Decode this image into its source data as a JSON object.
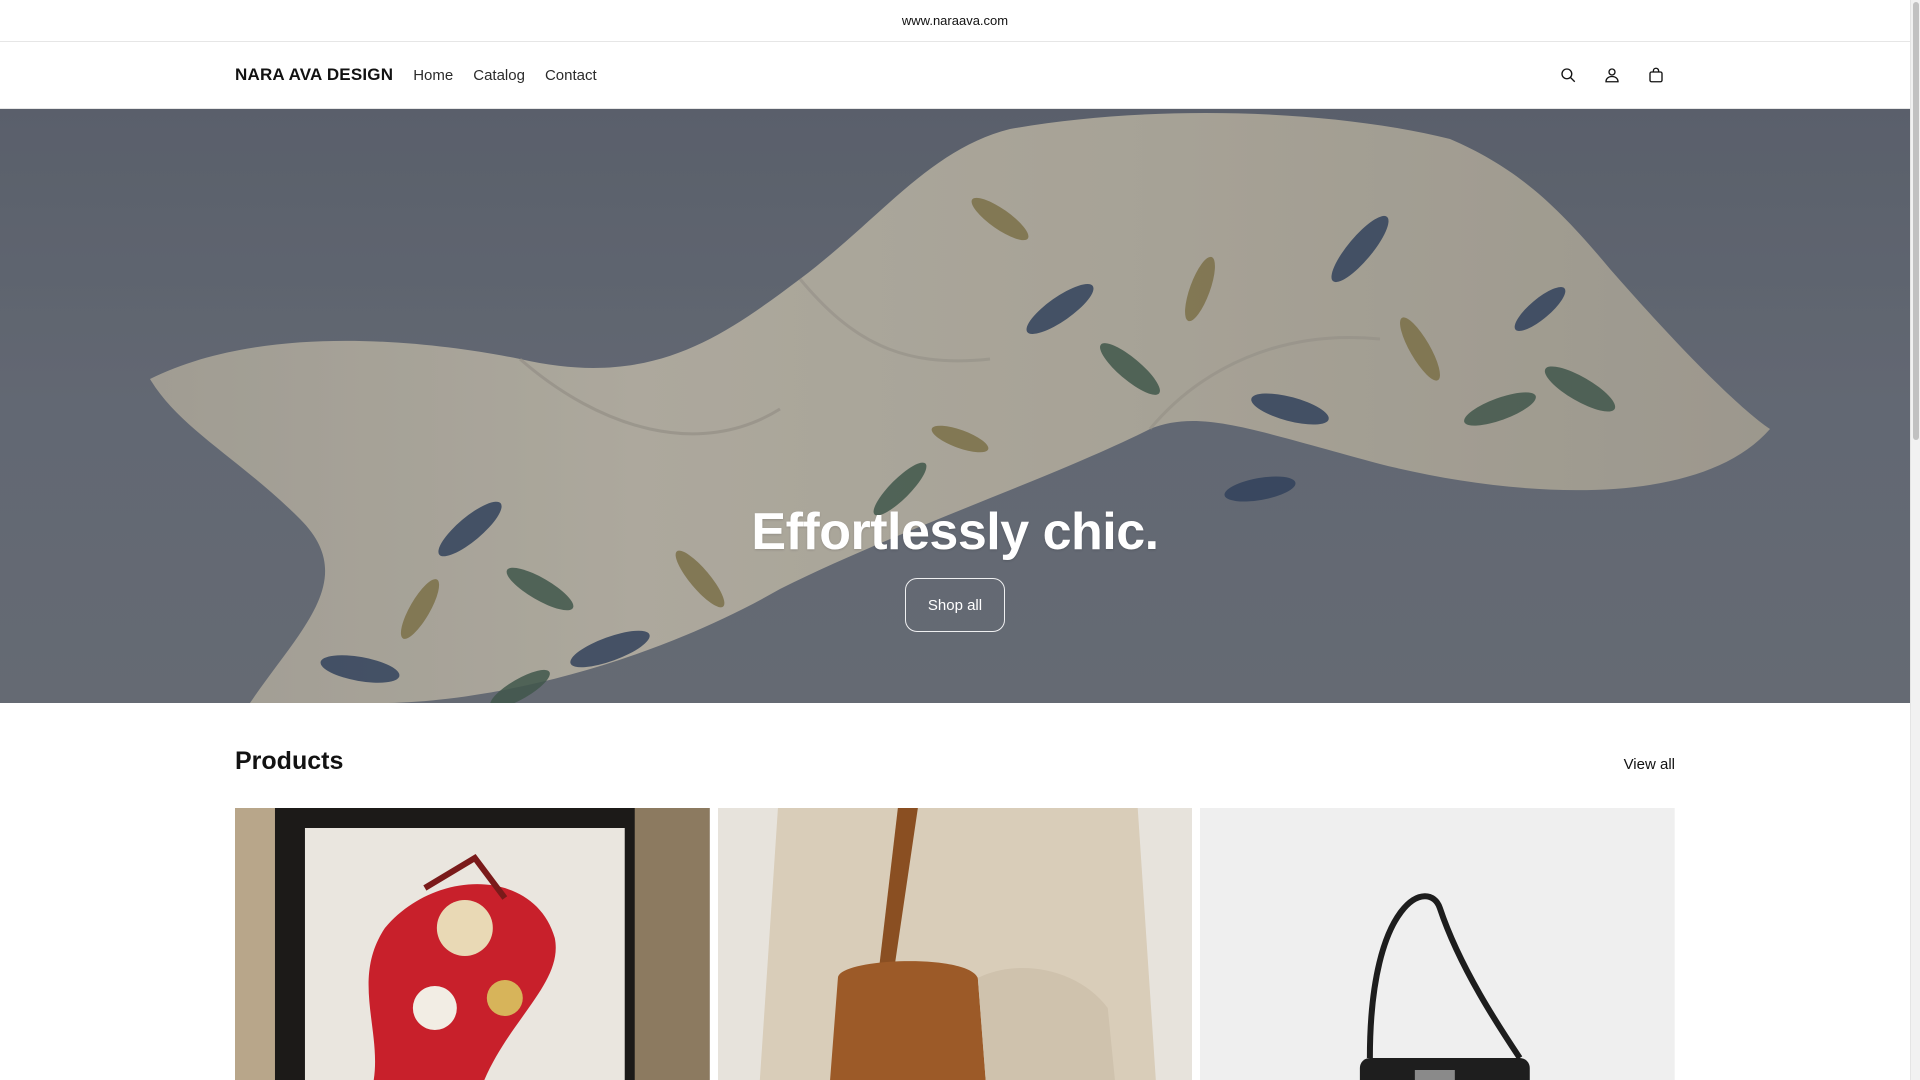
{
  "announcement": {
    "text": "www.naraava.com"
  },
  "header": {
    "logo": "NARA AVA DESIGN",
    "nav": [
      {
        "label": "Home"
      },
      {
        "label": "Catalog"
      },
      {
        "label": "Contact"
      }
    ],
    "icons": [
      "search-icon",
      "account-icon",
      "cart-icon"
    ]
  },
  "hero": {
    "title": "Effortlessly chic.",
    "button_label": "Shop all"
  },
  "products": {
    "title": "Products",
    "view_all_label": "View all"
  },
  "colors": {
    "text": "#121212",
    "hero_overlay": "#6a707b",
    "border": "#e6e6e6"
  }
}
